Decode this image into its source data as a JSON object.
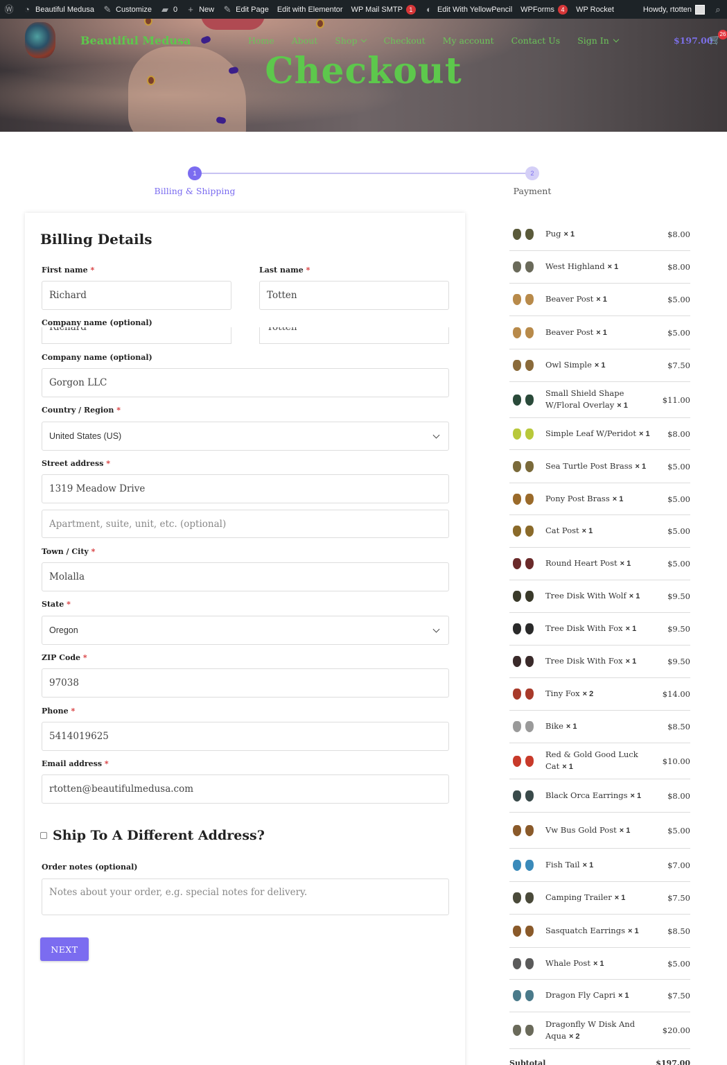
{
  "admin_bar": {
    "site_name": "Beautiful Medusa",
    "customize": "Customize",
    "comments_count": "0",
    "new": "New",
    "edit_page": "Edit Page",
    "edit_elementor": "Edit with Elementor",
    "wp_mail_smtp": "WP Mail SMTP",
    "wp_mail_smtp_badge": "1",
    "edit_yellowpencil": "Edit With YellowPencil",
    "wpforms": "WPForms",
    "wpforms_badge": "4",
    "wp_rocket": "WP Rocket",
    "howdy": "Howdy, rtotten"
  },
  "header": {
    "brand": "Beautiful Medusa",
    "nav": [
      "Home",
      "About",
      "Shop",
      "Checkout",
      "My account",
      "Contact Us",
      "Sign In"
    ],
    "cart_total": "$197.00",
    "cart_count": "26",
    "page_title": "Checkout"
  },
  "steps": [
    {
      "number": "1",
      "label": "Billing & Shipping"
    },
    {
      "number": "2",
      "label": "Payment"
    }
  ],
  "billing": {
    "heading": "Billing Details",
    "first_name_label": "First name",
    "first_name": "Richard",
    "last_name_label": "Last name",
    "last_name": "Totten",
    "company_label": "Company name (optional)",
    "company": "Gorgon LLC",
    "country_label": "Country / Region",
    "country": "United States (US)",
    "street_label": "Street address",
    "street": "1319 Meadow Drive",
    "street2_placeholder": "Apartment, suite, unit, etc. (optional)",
    "city_label": "Town / City",
    "city": "Molalla",
    "state_label": "State",
    "state": "Oregon",
    "zip_label": "ZIP Code",
    "zip": "97038",
    "phone_label": "Phone",
    "phone": "5414019625",
    "email_label": "Email address",
    "email": "rtotten@beautifulmedusa.com",
    "required_mark": "*",
    "ship_different": "Ship To A Different Address?",
    "notes_label": "Order notes (optional)",
    "notes_placeholder": "Notes about your order, e.g. special notes for delivery.",
    "next_button": "NEXT"
  },
  "order_items": [
    {
      "name": "Pug",
      "qty": "× 1",
      "price": "$8.00",
      "color": "#5a5a3a"
    },
    {
      "name": "West Highland",
      "qty": "× 1",
      "price": "$8.00",
      "color": "#6a6a5a"
    },
    {
      "name": "Beaver Post",
      "qty": "× 1",
      "price": "$5.00",
      "color": "#b88a4a"
    },
    {
      "name": "Beaver Post",
      "qty": "× 1",
      "price": "$5.00",
      "color": "#b88a4a"
    },
    {
      "name": "Owl Simple",
      "qty": "× 1",
      "price": "$7.50",
      "color": "#8a6a3a"
    },
    {
      "name": "Small Shield Shape W/Floral Overlay",
      "qty": "× 1",
      "price": "$11.00",
      "color": "#2a4a3a"
    },
    {
      "name": "Simple Leaf W/Peridot",
      "qty": "× 1",
      "price": "$8.00",
      "color": "#b8c83a"
    },
    {
      "name": "Sea Turtle Post Brass",
      "qty": "× 1",
      "price": "$5.00",
      "color": "#7a6a3a"
    },
    {
      "name": "Pony Post Brass",
      "qty": "× 1",
      "price": "$5.00",
      "color": "#9a6a2a"
    },
    {
      "name": "Cat Post",
      "qty": "× 1",
      "price": "$5.00",
      "color": "#8a6a2a"
    },
    {
      "name": "Round Heart Post",
      "qty": "× 1",
      "price": "$5.00",
      "color": "#6a2a2a"
    },
    {
      "name": "Tree Disk With Wolf",
      "qty": "× 1",
      "price": "$9.50",
      "color": "#3a3a2a"
    },
    {
      "name": "Tree Disk With Fox",
      "qty": "× 1",
      "price": "$9.50",
      "color": "#2a2a2a"
    },
    {
      "name": "Tree Disk With Fox",
      "qty": "× 1",
      "price": "$9.50",
      "color": "#3a2a2a"
    },
    {
      "name": "Tiny Fox",
      "qty": "× 2",
      "price": "$14.00",
      "color": "#a83a2a"
    },
    {
      "name": "Bike",
      "qty": "× 1",
      "price": "$8.50",
      "color": "#9a9a9a"
    },
    {
      "name": "Red & Gold Good Luck Cat",
      "qty": "× 1",
      "price": "$10.00",
      "color": "#c83a2a"
    },
    {
      "name": "Black Orca Earrings",
      "qty": "× 1",
      "price": "$8.00",
      "color": "#3a4a4a"
    },
    {
      "name": "Vw Bus Gold Post",
      "qty": "× 1",
      "price": "$5.00",
      "color": "#8a5a2a"
    },
    {
      "name": "Fish Tail",
      "qty": "× 1",
      "price": "$7.00",
      "color": "#3a8aba"
    },
    {
      "name": "Camping Trailer",
      "qty": "× 1",
      "price": "$7.50",
      "color": "#4a4a3a"
    },
    {
      "name": "Sasquatch Earrings",
      "qty": "× 1",
      "price": "$8.50",
      "color": "#8a5a2a"
    },
    {
      "name": "Whale Post",
      "qty": "× 1",
      "price": "$5.00",
      "color": "#5a5a5a"
    },
    {
      "name": "Dragon Fly Capri",
      "qty": "× 1",
      "price": "$7.50",
      "color": "#4a7a8a"
    },
    {
      "name": "Dragonfly W Disk And Aqua",
      "qty": "× 2",
      "price": "$20.00",
      "color": "#6a6a5a"
    }
  ],
  "subtotal": {
    "label": "Subtotal",
    "value": "$197.00"
  },
  "colors": {
    "accent": "#7b6cf0",
    "brand_green": "#5dc84c",
    "required": "#d63638"
  }
}
